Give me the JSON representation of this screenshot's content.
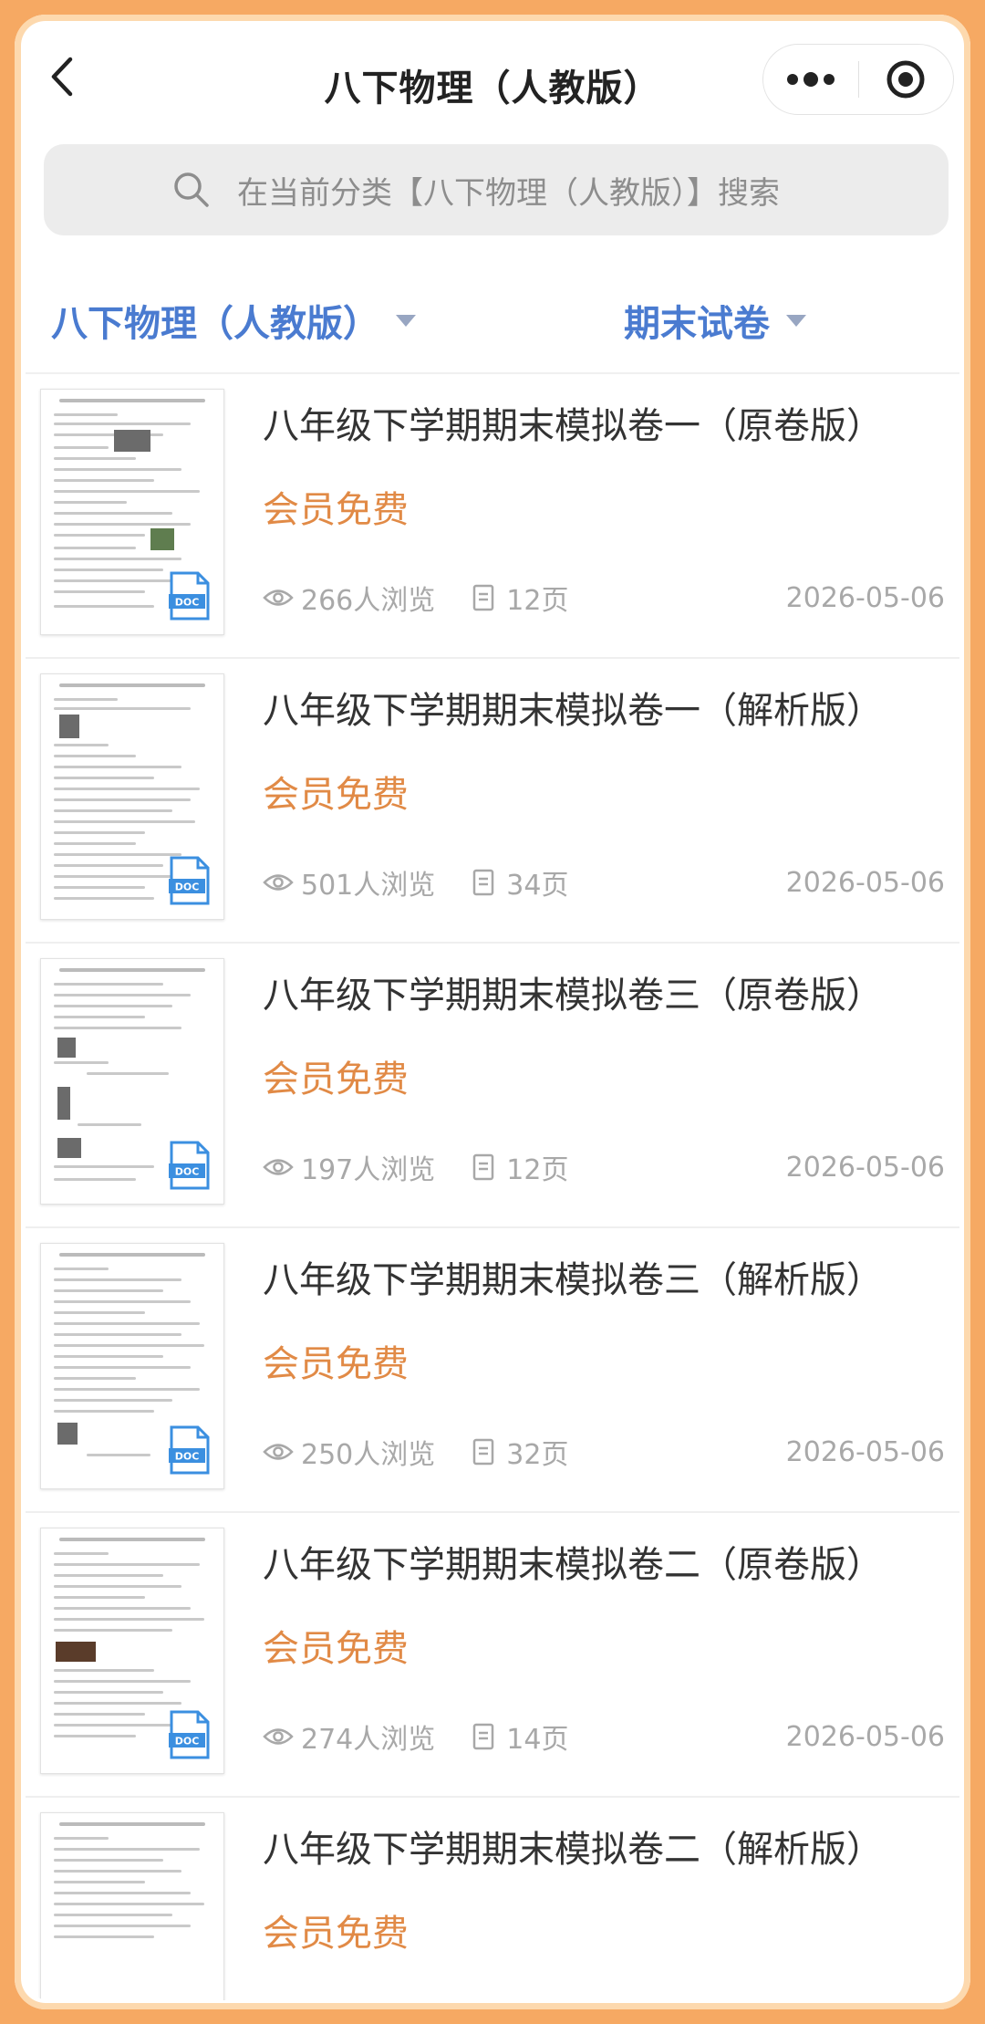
{
  "header": {
    "title": "八下物理（人教版）"
  },
  "search": {
    "placeholder": "在当前分类【八下物理（人教版）】搜索"
  },
  "filters": {
    "category": "八下物理（人教版）",
    "type": "期末试卷"
  },
  "colors": {
    "accent": "#4a7bd0",
    "member": "#e18a46",
    "frame": "#f6a963",
    "doc_badge": "#3b8fe0"
  },
  "list": [
    {
      "title": "八年级下学期期末模拟卷一（原卷版）",
      "badge": "会员免费",
      "views": "266人浏览",
      "pages": "12页",
      "date": "2026-05-06",
      "file_type": "DOC"
    },
    {
      "title": "八年级下学期期末模拟卷一（解析版）",
      "badge": "会员免费",
      "views": "501人浏览",
      "pages": "34页",
      "date": "2026-05-06",
      "file_type": "DOC"
    },
    {
      "title": "八年级下学期期末模拟卷三（原卷版）",
      "badge": "会员免费",
      "views": "197人浏览",
      "pages": "12页",
      "date": "2026-05-06",
      "file_type": "DOC"
    },
    {
      "title": "八年级下学期期末模拟卷三（解析版）",
      "badge": "会员免费",
      "views": "250人浏览",
      "pages": "32页",
      "date": "2026-05-06",
      "file_type": "DOC"
    },
    {
      "title": "八年级下学期期末模拟卷二（原卷版）",
      "badge": "会员免费",
      "views": "274人浏览",
      "pages": "14页",
      "date": "2026-05-06",
      "file_type": "DOC"
    },
    {
      "title": "八年级下学期期末模拟卷二（解析版）",
      "badge": "会员免费",
      "views": "",
      "pages": "",
      "date": "",
      "file_type": ""
    }
  ]
}
